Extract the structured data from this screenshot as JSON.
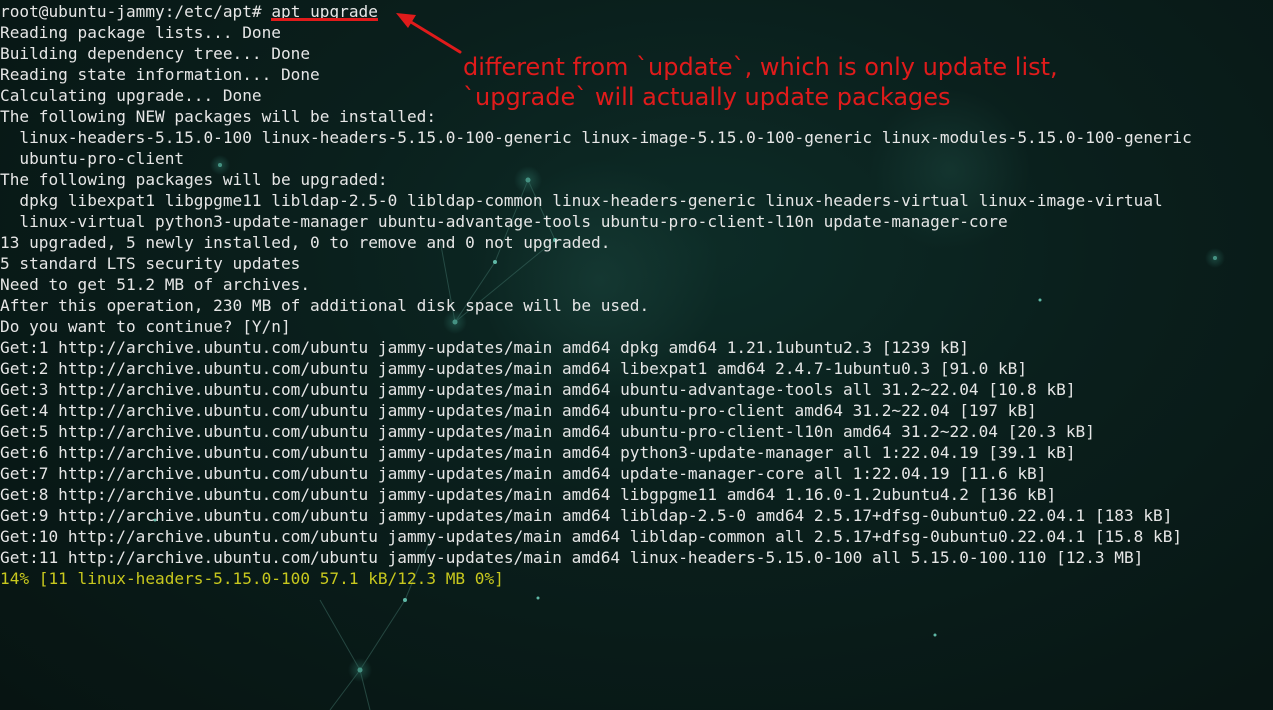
{
  "terminal": {
    "prompt": "root@ubuntu-jammy:/etc/apt# ",
    "command": "apt upgrade",
    "lines": [
      "Reading package lists... Done",
      "Building dependency tree... Done",
      "Reading state information... Done",
      "Calculating upgrade... Done",
      "The following NEW packages will be installed:",
      "  linux-headers-5.15.0-100 linux-headers-5.15.0-100-generic linux-image-5.15.0-100-generic linux-modules-5.15.0-100-generic",
      "  ubuntu-pro-client",
      "The following packages will be upgraded:",
      "  dpkg libexpat1 libgpgme11 libldap-2.5-0 libldap-common linux-headers-generic linux-headers-virtual linux-image-virtual",
      "  linux-virtual python3-update-manager ubuntu-advantage-tools ubuntu-pro-client-l10n update-manager-core",
      "13 upgraded, 5 newly installed, 0 to remove and 0 not upgraded.",
      "5 standard LTS security updates",
      "Need to get 51.2 MB of archives.",
      "After this operation, 230 MB of additional disk space will be used.",
      "Do you want to continue? [Y/n]",
      "Get:1 http://archive.ubuntu.com/ubuntu jammy-updates/main amd64 dpkg amd64 1.21.1ubuntu2.3 [1239 kB]",
      "Get:2 http://archive.ubuntu.com/ubuntu jammy-updates/main amd64 libexpat1 amd64 2.4.7-1ubuntu0.3 [91.0 kB]",
      "Get:3 http://archive.ubuntu.com/ubuntu jammy-updates/main amd64 ubuntu-advantage-tools all 31.2~22.04 [10.8 kB]",
      "Get:4 http://archive.ubuntu.com/ubuntu jammy-updates/main amd64 ubuntu-pro-client amd64 31.2~22.04 [197 kB]",
      "Get:5 http://archive.ubuntu.com/ubuntu jammy-updates/main amd64 ubuntu-pro-client-l10n amd64 31.2~22.04 [20.3 kB]",
      "Get:6 http://archive.ubuntu.com/ubuntu jammy-updates/main amd64 python3-update-manager all 1:22.04.19 [39.1 kB]",
      "Get:7 http://archive.ubuntu.com/ubuntu jammy-updates/main amd64 update-manager-core all 1:22.04.19 [11.6 kB]",
      "Get:8 http://archive.ubuntu.com/ubuntu jammy-updates/main amd64 libgpgme11 amd64 1.16.0-1.2ubuntu4.2 [136 kB]",
      "Get:9 http://archive.ubuntu.com/ubuntu jammy-updates/main amd64 libldap-2.5-0 amd64 2.5.17+dfsg-0ubuntu0.22.04.1 [183 kB]",
      "Get:10 http://archive.ubuntu.com/ubuntu jammy-updates/main amd64 libldap-common all 2.5.17+dfsg-0ubuntu0.22.04.1 [15.8 kB]",
      "Get:11 http://archive.ubuntu.com/ubuntu jammy-updates/main amd64 linux-headers-5.15.0-100 all 5.15.0-100.110 [12.3 MB]"
    ],
    "progress": "14% [11 linux-headers-5.15.0-100 57.1 kB/12.3 MB 0%]"
  },
  "annotation": {
    "line1": "different from `update`, which is only update list,",
    "line2": "`upgrade` will actually update packages"
  },
  "colors": {
    "background": "#0a1f1c",
    "text": "#e6e6e6",
    "progress": "#c8c81e",
    "annotation": "#e01b1b"
  }
}
